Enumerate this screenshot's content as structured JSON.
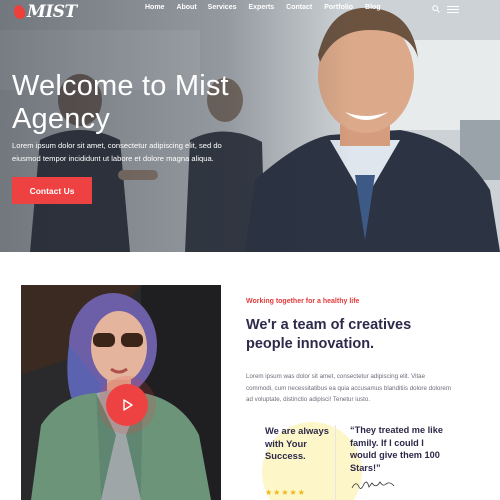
{
  "brand": {
    "logo_text": "MIST"
  },
  "nav": {
    "items": [
      "Home",
      "About",
      "Services",
      "Experts",
      "Contact",
      "Portfolio",
      "Blog"
    ]
  },
  "hero": {
    "title": "Welcome to Mist Agency",
    "text": "Lorem ipsum dolor sit amet, consectetur adipiscing elit, sed do eiusmod tempor incididunt ut labore et dolore magna aliqua.",
    "button": "Contact Us"
  },
  "about": {
    "tagline": "Working together for a healthy life",
    "title": "We'r a team of creatives people innovation.",
    "text": "Lorem ipsum was dolor sit amet, consectetur adipiscing elit. Vitae commodi, cum necessitatibus ea quia accusamus blanditiis dolore dolorem ad voluptate, distinctio adipisci! Tenetur iusto.",
    "highlight": "We are always with Your Success.",
    "quote": "“They treated me like family. If I could I would give them 100 Stars!”",
    "stars": "★★★★★"
  },
  "colors": {
    "accent": "#ee4242",
    "heading": "#2d2a4a",
    "star": "#f2b61c"
  },
  "icons": [
    "search-icon",
    "menu-icon",
    "play-icon"
  ]
}
